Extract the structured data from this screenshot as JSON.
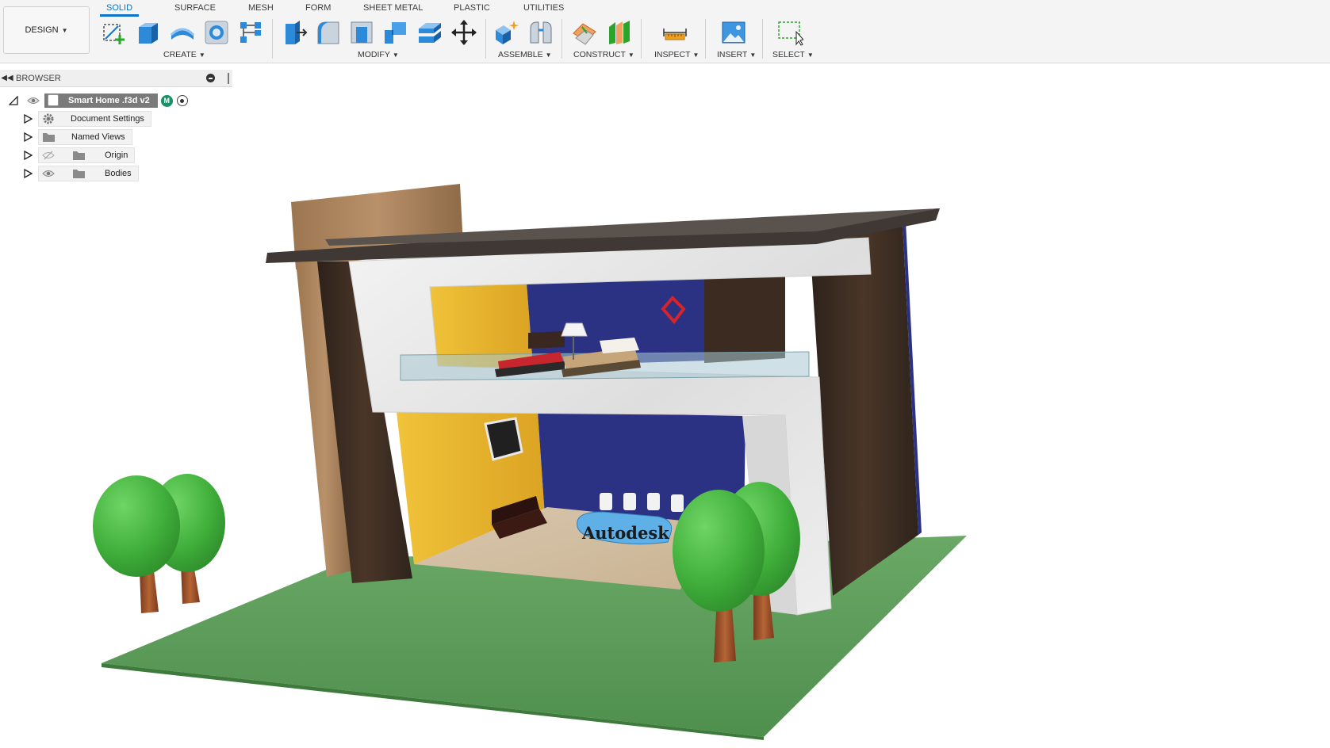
{
  "workspace": {
    "label": "DESIGN"
  },
  "tabs": [
    {
      "label": "SOLID",
      "active": true
    },
    {
      "label": "SURFACE"
    },
    {
      "label": "MESH"
    },
    {
      "label": "FORM"
    },
    {
      "label": "SHEET METAL"
    },
    {
      "label": "PLASTIC"
    },
    {
      "label": "UTILITIES"
    }
  ],
  "groups": {
    "create": "CREATE",
    "modify": "MODIFY",
    "assemble": "ASSEMBLE",
    "construct": "CONSTRUCT",
    "inspect": "INSPECT",
    "insert": "INSERT",
    "select": "SELECT"
  },
  "tools": [
    {
      "icon": "create-sketch-icon",
      "group": "create"
    },
    {
      "icon": "extrude-icon",
      "group": "create"
    },
    {
      "icon": "revolve-icon",
      "group": "create"
    },
    {
      "icon": "hole-icon",
      "group": "create"
    },
    {
      "icon": "pattern-icon",
      "group": "create"
    },
    {
      "icon": "press-pull-icon",
      "group": "modify"
    },
    {
      "icon": "fillet-icon",
      "group": "modify"
    },
    {
      "icon": "shell-icon",
      "group": "modify"
    },
    {
      "icon": "combine-icon",
      "group": "modify"
    },
    {
      "icon": "offset-face-icon",
      "group": "modify"
    },
    {
      "icon": "move-icon",
      "group": "modify"
    },
    {
      "icon": "new-component-icon",
      "group": "assemble"
    },
    {
      "icon": "joint-icon",
      "group": "assemble"
    },
    {
      "icon": "offset-plane-icon",
      "group": "construct"
    },
    {
      "icon": "midplane-icon",
      "group": "construct"
    },
    {
      "icon": "measure-icon",
      "group": "inspect"
    },
    {
      "icon": "insert-image-icon",
      "group": "insert"
    },
    {
      "icon": "window-select-icon",
      "group": "select"
    }
  ],
  "browser": {
    "title": "BROWSER",
    "root": {
      "label": "Smart Home .f3d v2",
      "badge": "M"
    },
    "items": [
      {
        "label": "Document Settings",
        "icon": "gear-icon"
      },
      {
        "label": "Named Views",
        "icon": "folder-icon"
      },
      {
        "label": "Origin",
        "icon": "folder-icon",
        "visibility": "hidden"
      },
      {
        "label": "Bodies",
        "icon": "folder-icon",
        "visibility": "visible"
      }
    ]
  },
  "model": {
    "sign_text": "Autodesk",
    "colors": {
      "grass": "#5f9e5c",
      "wall_yellow": "#e7b52a",
      "wall_blue": "#2a2f80",
      "marble": "#e6e6e6",
      "dark_wood": "#3a2a20",
      "light_wood": "#b08a63",
      "tree_green": "#46b441",
      "trunk": "#9a4f2a",
      "roof": "#3d3632"
    }
  }
}
